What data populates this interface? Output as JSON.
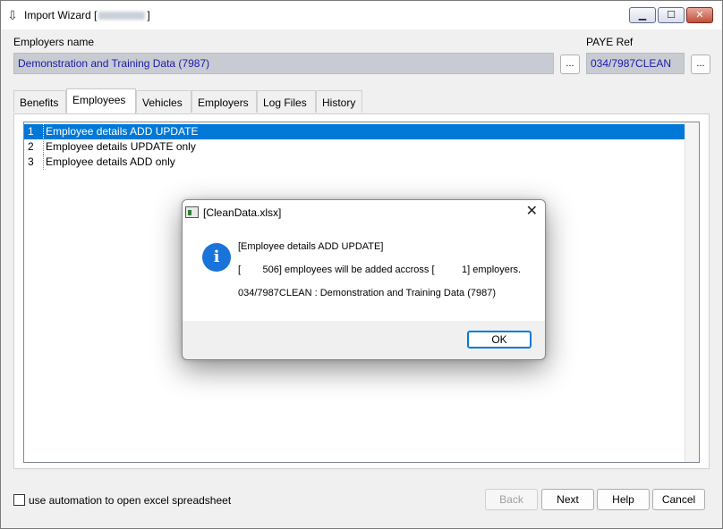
{
  "window": {
    "title": "Import Wizard [",
    "title_suffix": "]",
    "buttons": {
      "minimize": "▁",
      "maximize": "☐",
      "close": "✕"
    }
  },
  "employer": {
    "label": "Employers name",
    "value": "Demonstration and Training Data (7987)",
    "browse_label": "..."
  },
  "paye": {
    "label": "PAYE Ref",
    "value": "034/7987CLEAN",
    "browse_label": "..."
  },
  "tabs": [
    {
      "label": "Benefits"
    },
    {
      "label": "Employees"
    },
    {
      "label": "Vehicles"
    },
    {
      "label": "Employers"
    },
    {
      "label": "Log Files"
    },
    {
      "label": "History"
    }
  ],
  "list": [
    {
      "num": "1",
      "text": "Employee details ADD UPDATE"
    },
    {
      "num": "2",
      "text": "Employee details UPDATE only"
    },
    {
      "num": "3",
      "text": "Employee details ADD only"
    }
  ],
  "automation_label": "use automation to open excel spreadsheet",
  "buttons": {
    "back": "Back",
    "next": "Next",
    "help": "Help",
    "cancel": "Cancel"
  },
  "dialog": {
    "title": "[CleanData.xlsx]",
    "close": "✕",
    "icon": "i",
    "line1": "[Employee details ADD UPDATE]",
    "line2": "[        506] employees will be added accross [          1] employers.",
    "line3": "034/7987CLEAN : Demonstration and Training Data (7987)",
    "ok": "OK"
  },
  "colors": {
    "selection": "#0078d7",
    "field_text": "#1a1aa8",
    "info_icon": "#1a73d9"
  }
}
